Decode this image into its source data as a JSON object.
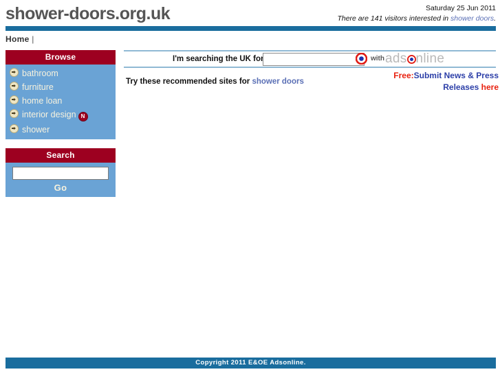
{
  "header": {
    "site_title": "shower-doors.org.uk",
    "date": "Saturday 25 Jun 2011",
    "visitors_prefix": "There are 141 visitors interested in ",
    "visitors_link": "shower doors",
    "visitors_suffix": ".",
    "bar_color": "#1a6d9e"
  },
  "nav": {
    "home_label": "Home",
    "separator": "|"
  },
  "sidebar": {
    "browse": {
      "title": "Browse",
      "head_color": "#9d0020",
      "body_color": "#6aa3d5",
      "items": [
        {
          "label": "bathroom",
          "icon": "arrow-circle-icon",
          "badge": ""
        },
        {
          "label": "furniture",
          "icon": "arrow-circle-icon",
          "badge": ""
        },
        {
          "label": "home loan",
          "icon": "arrow-circle-icon",
          "badge": ""
        },
        {
          "label": "interior design",
          "icon": "arrow-circle-icon",
          "badge": "N"
        },
        {
          "label": "shower",
          "icon": "arrow-circle-icon",
          "badge": ""
        }
      ]
    },
    "search": {
      "title": "Search",
      "input_value": "",
      "input_placeholder": "",
      "go_label": "Go"
    }
  },
  "main": {
    "search_label": "I'm searching the UK for...",
    "search_input_value": "",
    "search_input_placeholder": "",
    "brand_with": "with",
    "brand_part1": "ads",
    "brand_part2": "nline",
    "target_icon": "target-ring-icon",
    "recommend_prefix": "Try these recommended sites for ",
    "recommend_link": "shower doors",
    "promo_line1_red": "Free:",
    "promo_line1_blue": "Submit News & Press",
    "promo_line2_blue": "Releases ",
    "promo_line2_red": "here"
  },
  "footer": {
    "copyright": "Copyright 2011 E&OE Adsonline.",
    "bar_color": "#1a6d9e"
  }
}
